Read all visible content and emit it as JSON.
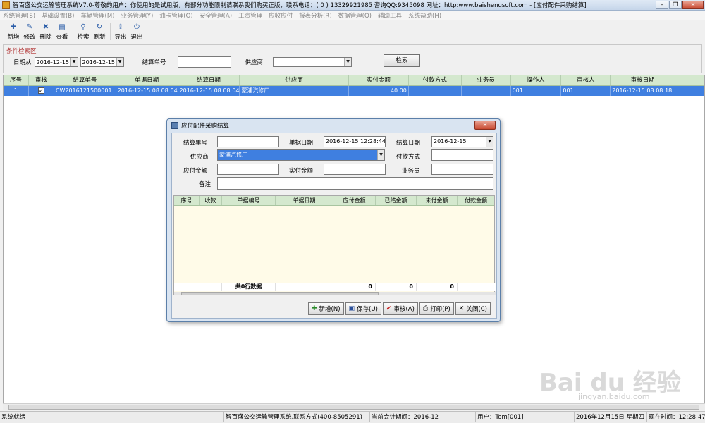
{
  "window": {
    "title": "智百盛公交运输管理系统V7.0-尊敬的用户：你使用的是试用版，有部分功能限制请联系我们购买正版，联系电话：( 0 ) 13329921985  咨询QQ:9345098  网址：http:www.baishengsoft.com - [应付配件采购结算]"
  },
  "menu": [
    "系统管理(S)",
    "基础设置(B)",
    "车辆管理(M)",
    "业务管理(Y)",
    "油卡管理(O)",
    "安全管理(A)",
    "工资管理",
    "应收应付",
    "报表分析(R)",
    "数据管理(Q)",
    "辅助工具",
    "系统帮助(H)"
  ],
  "toolbar": {
    "new": "新增",
    "edit": "修改",
    "delete": "删除",
    "view": "查看",
    "search": "检索",
    "refresh": "刷新",
    "export": "导出",
    "exit": "退出"
  },
  "search": {
    "section_title": "条件检索区",
    "date_from_label": "日期从",
    "date_from": "2016-12-15",
    "date_to": "2016-12-15",
    "settle_no_label": "结算单号",
    "supplier_label": "供应商",
    "button": "检索"
  },
  "grid": {
    "columns": [
      "序号",
      "审核",
      "结算单号",
      "单据日期",
      "结算日期",
      "供应商",
      "实付金额",
      "付款方式",
      "业务员",
      "操作人",
      "审核人",
      "审核日期"
    ],
    "rows": [
      {
        "seq": "1",
        "checked": "✓",
        "settle_no": "CW2016121500001",
        "doc_date": "2016-12-15 08:08:04",
        "settle_date": "2016-12-15 08:08:04",
        "supplier": "蒙浦汽修厂",
        "amount": "40.00",
        "pay_method": "",
        "salesman": "",
        "operator": "001",
        "auditor": "001",
        "audit_date": "2016-12-15 08:08:18"
      }
    ]
  },
  "status": {
    "ready": "系统就绪",
    "system": "智百盛公交运输管理系统,联系方式(400-8505291)",
    "period": "当前会计期间：2016-12",
    "user": "用户：Tom[001]",
    "date": "2016年12月15日 星期四",
    "time": "现在时间：12:28:47"
  },
  "dialog": {
    "title": "应付配件采购结算",
    "settle_no_label": "结算单号",
    "settle_no": "",
    "doc_date_label": "单据日期",
    "doc_date": "2016-12-15 12:28:44",
    "settle_date_label": "结算日期",
    "settle_date": "2016-12-15",
    "supplier_label": "供应商",
    "supplier": "蒙浦汽修厂",
    "pay_method_label": "付款方式",
    "payable_label": "应付金额",
    "paid_label": "实付金额",
    "salesman_label": "业务员",
    "note_label": "备注",
    "columns": [
      "序号",
      "收款",
      "单据编号",
      "单据日期",
      "应付金额",
      "已结金额",
      "未付金额",
      "付款金额"
    ],
    "total_label": "共0行数据",
    "totals": [
      "0",
      "0",
      "0"
    ],
    "buttons": {
      "new": "新增(N)",
      "save": "保存(U)",
      "audit": "审核(A)",
      "print": "打印(P)",
      "close": "关闭(C)"
    }
  },
  "watermark": {
    "brand": "Bai du 经验",
    "url": "jingyan.baidu.com"
  }
}
